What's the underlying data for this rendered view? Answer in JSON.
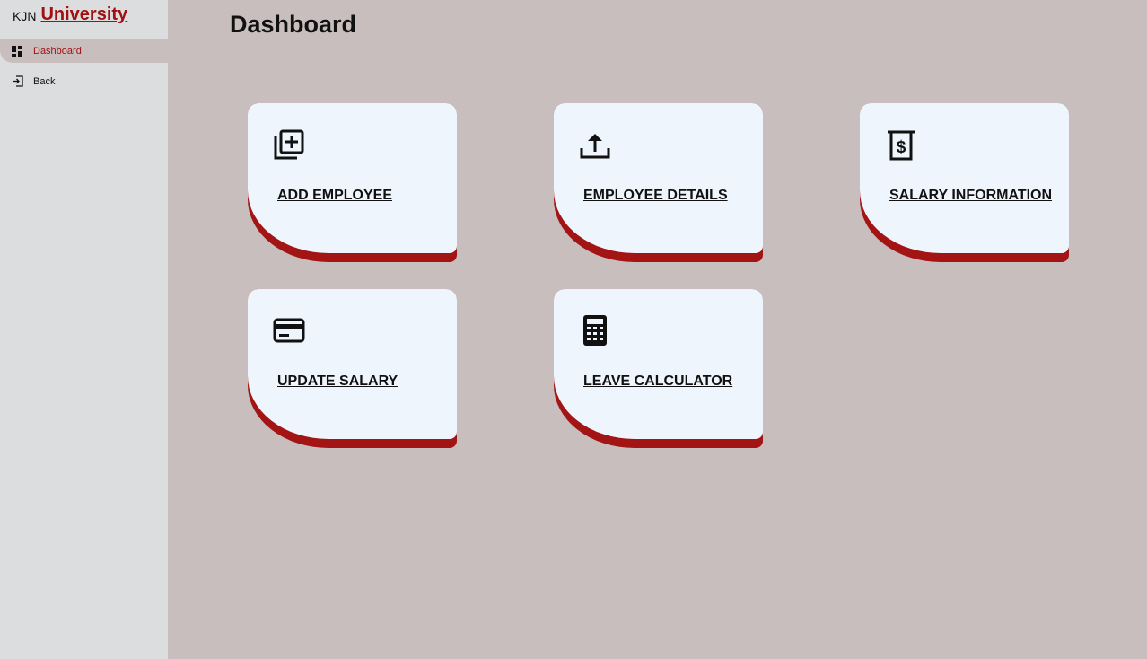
{
  "brand": {
    "prefix": "KJN",
    "name": "University"
  },
  "sidebar": {
    "items": [
      {
        "label": "Dashboard",
        "icon": "dashboard-icon",
        "active": true
      },
      {
        "label": "Back",
        "icon": "back-exit-icon",
        "active": false
      }
    ]
  },
  "header": {
    "title": "Dashboard"
  },
  "cards": [
    {
      "label": "ADD EMPLOYEE",
      "icon": "add-to-library-icon"
    },
    {
      "label": "EMPLOYEE DETAILS",
      "icon": "upload-icon"
    },
    {
      "label": "SALARY INFORMATION",
      "icon": "receipt-dollar-icon"
    },
    {
      "label": "UPDATE SALARY",
      "icon": "credit-card-icon"
    },
    {
      "label": "LEAVE CALCULATOR",
      "icon": "calculator-icon"
    }
  ],
  "colors": {
    "accent": "#a01010",
    "card_shadow": "#a31414",
    "card_face": "#eef5fc",
    "sidebar_bg": "#dcdddf",
    "main_bg": "#c9bebe"
  }
}
